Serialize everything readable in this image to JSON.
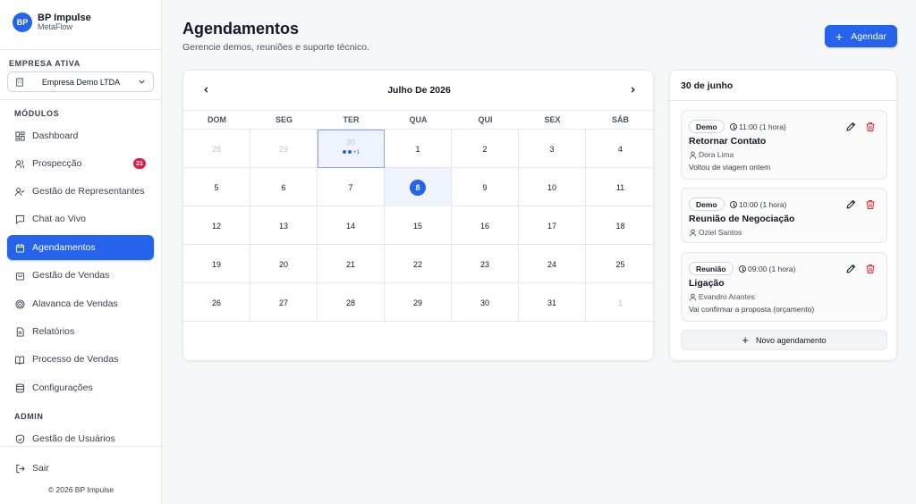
{
  "brand": {
    "logo": "BP",
    "name": "BP Impulse",
    "sub": "MetaFlow"
  },
  "company": {
    "label": "EMPRESA ATIVA",
    "selected": "Empresa Demo LTDA"
  },
  "modules_label": "MÓDULOS",
  "nav": [
    {
      "label": "Dashboard",
      "icon": "dashboard-icon"
    },
    {
      "label": "Prospecção",
      "icon": "users-icon",
      "badge": "21"
    },
    {
      "label": "Gestão de Representantes",
      "icon": "user-check-icon"
    },
    {
      "label": "Chat ao Vivo",
      "icon": "chat-icon"
    },
    {
      "label": "Agendamentos",
      "icon": "calendar-icon",
      "active": true
    },
    {
      "label": "Gestão de Vendas",
      "icon": "shopping-bag-icon"
    },
    {
      "label": "Alavanca de Vendas",
      "icon": "target-icon"
    },
    {
      "label": "Relatórios",
      "icon": "file-icon"
    },
    {
      "label": "Processo de Vendas",
      "icon": "book-icon"
    },
    {
      "label": "Configurações",
      "icon": "database-icon"
    }
  ],
  "admin_label": "ADMIN",
  "admin_nav": [
    {
      "label": "Gestão de Usuários",
      "icon": "shield-icon"
    }
  ],
  "logout": "Sair",
  "copyright": "© 2026 BP Impulse",
  "header": {
    "title": "Agendamentos",
    "subtitle": "Gerencie demos, reuniões e suporte técnico.",
    "new_button": "Agendar"
  },
  "calendar": {
    "month_label": "Julho De 2026",
    "weekdays": [
      "DOM",
      "SEG",
      "TER",
      "QUA",
      "QUI",
      "SEX",
      "SÁB"
    ],
    "weeks": [
      [
        "28",
        "29",
        "30",
        "1",
        "2",
        "3",
        "4"
      ],
      [
        "5",
        "6",
        "7",
        "8",
        "9",
        "10",
        "11"
      ],
      [
        "12",
        "13",
        "14",
        "15",
        "16",
        "17",
        "18"
      ],
      [
        "19",
        "20",
        "21",
        "22",
        "23",
        "24",
        "25"
      ],
      [
        "26",
        "27",
        "28",
        "29",
        "30",
        "31",
        "1"
      ]
    ],
    "selected_more": "+1"
  },
  "day_panel": {
    "title": "30 de junho",
    "appointments": [
      {
        "tag": "Demo",
        "time": "11:00 (1 hora)",
        "title": "Retornar Contato",
        "person": "Dora Lima",
        "note": "Voltou de viagem ontem"
      },
      {
        "tag": "Demo",
        "time": "10:00 (1 hora)",
        "title": "Reunião de Negociação",
        "person": "Oziel Santos",
        "note": ""
      },
      {
        "tag": "Reunião",
        "time": "09:00 (1 hora)",
        "title": "Ligação",
        "person": "Evandro Arantes",
        "note": "Vai confirmar a proposta (orçamento)"
      }
    ],
    "new_button": "Novo agendamento"
  },
  "colors": {
    "accent": "#2563eb",
    "badge": "#e11d48",
    "delete": "#dc2626"
  }
}
